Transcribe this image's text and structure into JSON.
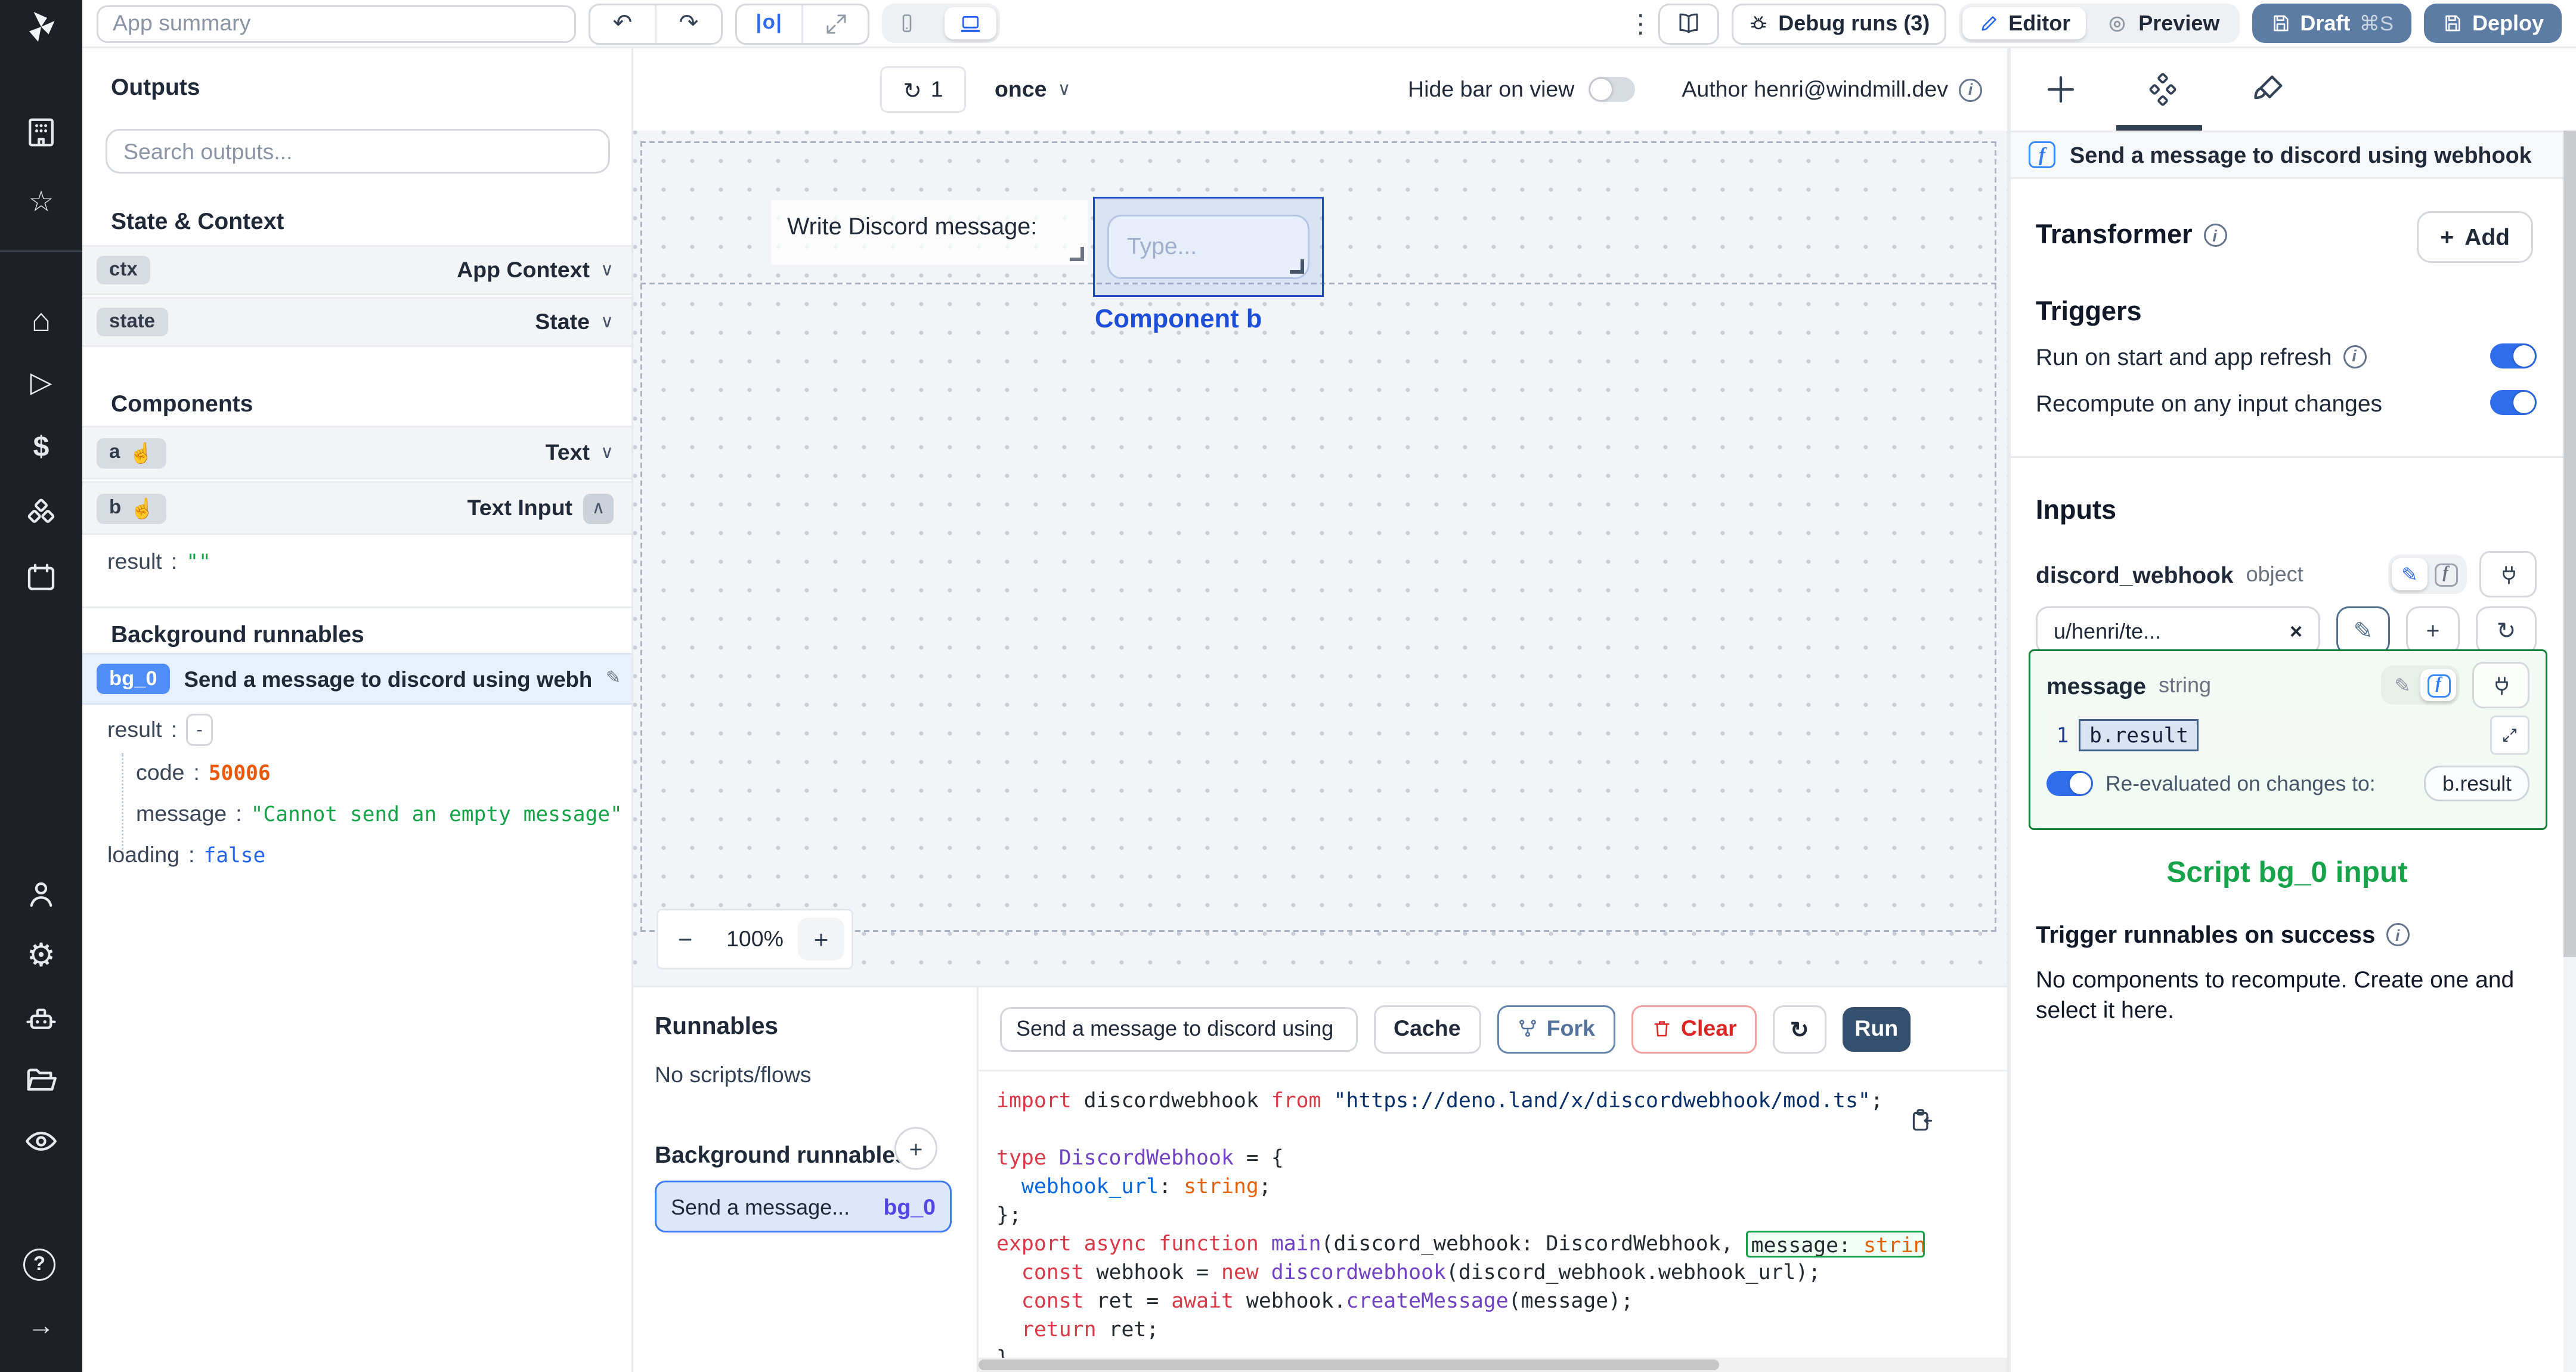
{
  "icons": {
    "undo": "↶",
    "redo": "↷",
    "kebab": "⋮",
    "refresh": "↻",
    "chevron_down": "∨",
    "chevron_up": "∧",
    "star": "☆",
    "home": "⌂",
    "play": "▷",
    "dollar": "$",
    "gear": "⚙",
    "arrow_right": "→",
    "hand": "☝",
    "pencil": "✎",
    "close": "×",
    "plus": "+",
    "minus": "−",
    "align": "|o|",
    "info": "i",
    "help": "?",
    "f": "f"
  },
  "topbar": {
    "app_summary_placeholder": "App summary",
    "debug_runs": "Debug runs (3)",
    "editor": "Editor",
    "preview": "Preview",
    "draft": "Draft",
    "draft_shortcut": "⌘S",
    "deploy": "Deploy"
  },
  "canvas_toolbar": {
    "refresh_count": "1",
    "schedule": "once",
    "hide_bar": "Hide bar on view",
    "author": "Author henri@windmill.dev"
  },
  "canvas": {
    "text_component": "Write Discord message:",
    "input_placeholder": "Type...",
    "selected_label": "Component b",
    "zoom": "100%"
  },
  "outputs": {
    "title": "Outputs",
    "search_placeholder": "Search outputs...",
    "state_context": "State & Context",
    "ctx": {
      "key": "ctx",
      "type": "App Context"
    },
    "state": {
      "key": "state",
      "type": "State"
    },
    "components_title": "Components",
    "comp_a": {
      "key": "a",
      "type": "Text"
    },
    "comp_b": {
      "key": "b",
      "type": "Text Input"
    },
    "b_result": {
      "k": "result",
      "v": "\"\""
    },
    "bg_title": "Background runnables",
    "bg0": {
      "badge": "bg_0",
      "label": "Send a message to discord using webhook"
    },
    "bg0_result": {
      "k": "result",
      "v": "-"
    },
    "kv": [
      {
        "k": "code",
        "v": "50006"
      },
      {
        "k": "message",
        "v": "\"Cannot send an empty message\""
      },
      {
        "k": "loading",
        "v": "false"
      }
    ]
  },
  "runnables": {
    "title": "Runnables",
    "empty": "No scripts/flows",
    "bg_title": "Background runnables",
    "item_label": "Send a message...",
    "item_badge": "bg_0"
  },
  "editor": {
    "name_field": "Send a message to discord using",
    "cache": "Cache",
    "fork": "Fork",
    "clear": "Clear",
    "run": "Run",
    "code_lines": [
      [
        {
          "t": "import ",
          "c": "kw"
        },
        {
          "t": "discordwebhook ",
          "c": "id"
        },
        {
          "t": "from ",
          "c": "kw"
        },
        {
          "t": "\"https://deno.land/x/discordwebhook/mod.ts\"",
          "c": "str"
        },
        {
          "t": ";",
          "c": "id"
        }
      ],
      [],
      [
        {
          "t": "type ",
          "c": "kw"
        },
        {
          "t": "DiscordWebhook ",
          "c": "ty"
        },
        {
          "t": "= {",
          "c": "id"
        }
      ],
      [
        {
          "t": "  ",
          "c": "id"
        },
        {
          "t": "webhook_url",
          "c": "pr"
        },
        {
          "t": ": ",
          "c": "id"
        },
        {
          "t": "string",
          "c": "ts"
        },
        {
          "t": ";",
          "c": "id"
        }
      ],
      [
        {
          "t": "};",
          "c": "id"
        }
      ],
      [
        {
          "t": "export ",
          "c": "kw"
        },
        {
          "t": "async ",
          "c": "kw"
        },
        {
          "t": "function ",
          "c": "kw"
        },
        {
          "t": "main",
          "c": "ty"
        },
        {
          "t": "(discord_webhook: DiscordWebhook, ",
          "c": "id"
        },
        {
          "t": "message: ",
          "c": "id",
          "box": true
        },
        {
          "t": "string",
          "c": "ts",
          "box": true
        }
      ],
      [
        {
          "t": "  ",
          "c": "id"
        },
        {
          "t": "const ",
          "c": "kw"
        },
        {
          "t": "webhook = ",
          "c": "id"
        },
        {
          "t": "new ",
          "c": "kw"
        },
        {
          "t": "discordwebhook",
          "c": "ty"
        },
        {
          "t": "(discord_webhook.webhook_url);",
          "c": "id"
        }
      ],
      [
        {
          "t": "  ",
          "c": "id"
        },
        {
          "t": "const ",
          "c": "kw"
        },
        {
          "t": "ret = ",
          "c": "id"
        },
        {
          "t": "await ",
          "c": "kw"
        },
        {
          "t": "webhook.",
          "c": "id"
        },
        {
          "t": "createMessage",
          "c": "ty"
        },
        {
          "t": "(message);",
          "c": "id"
        }
      ],
      [
        {
          "t": "  ",
          "c": "id"
        },
        {
          "t": "return ",
          "c": "kw"
        },
        {
          "t": "ret;",
          "c": "id"
        }
      ],
      [
        {
          "t": "}",
          "c": "id"
        }
      ]
    ]
  },
  "right_panel": {
    "header": "Send a message to discord using webhook",
    "transformer": "Transformer",
    "add": "Add",
    "triggers": "Triggers",
    "run_on_start": "Run on start and app refresh",
    "recompute": "Recompute on any input changes",
    "inputs_title": "Inputs",
    "discord_webhook": {
      "name": "discord_webhook",
      "type": "object",
      "value": "u/henri/te..."
    },
    "message": {
      "name": "message",
      "type": "string",
      "line_no": "1",
      "expr": "b.result",
      "reeval": "Re-evaluated on changes to:",
      "reeval_target": "b.result"
    },
    "script_input_label": "Script bg_0 input",
    "trigger_success": "Trigger runnables on success",
    "no_components": "No components to recompute. Create one and select it here."
  },
  "colors": {
    "accent_blue": "#2563eb",
    "selection_blue": "#1d4ed8",
    "green": "#16a34a",
    "code_value_orange": "#e8590c",
    "false_blue": "#2563eb",
    "draft_button": "#5d7ca4",
    "run_button": "#35506e",
    "bg0_badge": "#4f8ef7"
  }
}
